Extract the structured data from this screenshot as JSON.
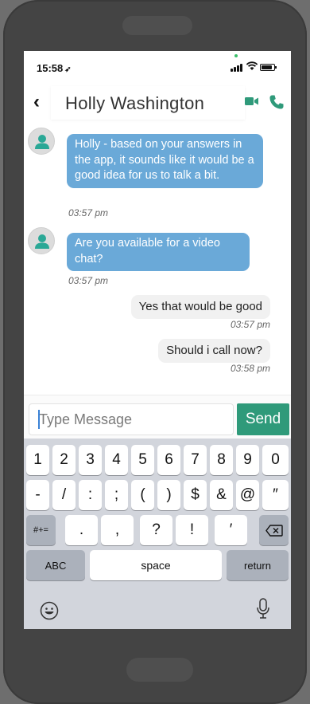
{
  "status": {
    "time": "15:58",
    "location_glyph": "➶"
  },
  "header": {
    "back_glyph": "‹",
    "title": "Holly Washington",
    "accent": "#2f9a7a"
  },
  "messages": [
    {
      "direction": "in",
      "text": "Holly - based on your answers in the app, it sounds like it would be a good idea for us to talk a bit.",
      "time": "03:57 pm"
    },
    {
      "direction": "in",
      "text": "Are you available for a video chat?",
      "time": "03:57 pm"
    },
    {
      "direction": "out",
      "text": "Yes  that would be good",
      "time": "03:57 pm"
    },
    {
      "direction": "out",
      "text": "Should i call now?",
      "time": "03:58 pm"
    }
  ],
  "composer": {
    "placeholder": "Type Message",
    "send_label": "Send",
    "send_color": "#2f9a7a"
  },
  "keyboard": {
    "row1": [
      "1",
      "2",
      "3",
      "4",
      "5",
      "6",
      "7",
      "8",
      "9",
      "0"
    ],
    "row2": [
      "-",
      "/",
      ":",
      ";",
      "(",
      ")",
      "$",
      "&",
      "@",
      "″"
    ],
    "row3_mode": "#+=",
    "row3": [
      ".",
      ",",
      "?",
      "!",
      "′"
    ],
    "abc": "ABC",
    "space": "space",
    "return": "return",
    "delete_icon": "backspace-icon",
    "emoji_icon": "emoji-icon",
    "mic_icon": "microphone-icon"
  }
}
